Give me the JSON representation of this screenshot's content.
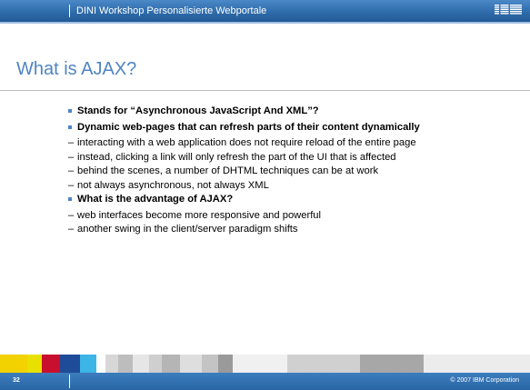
{
  "header": {
    "text": "DINI Workshop Personalisierte Webportale",
    "logo": "IBM"
  },
  "slide": {
    "title": "What is AJAX?",
    "items": [
      {
        "type": "bullet",
        "text": "Stands for “Asynchronous JavaScript And XML”?"
      },
      {
        "type": "bullet",
        "text": "Dynamic web-pages that can refresh parts of their content dynamically"
      },
      {
        "type": "dash",
        "text": "interacting with a web application does not require reload of the entire page"
      },
      {
        "type": "dash",
        "text": "instead, clicking a link will only refresh the part of the UI that is affected"
      },
      {
        "type": "dash",
        "text": "behind the scenes, a number of DHTML techniques can be at work"
      },
      {
        "type": "dash",
        "text": "not always asynchronous, not always XML"
      },
      {
        "type": "bullet",
        "text": "What is the advantage of AJAX?"
      },
      {
        "type": "dash",
        "text": "web interfaces become more responsive and powerful"
      },
      {
        "type": "dash",
        "text": "another swing in the client/server paradigm shifts"
      }
    ],
    "dash_char": "–"
  },
  "footer": {
    "page_number": "32",
    "copyright": "© 2007 IBM Corporation"
  },
  "colors": {
    "header_blue": "#2f6cab",
    "title_blue": "#4f84c4",
    "bullet_blue": "#4f84c4",
    "footer_stripe": [
      "#f2d200",
      "#e8e100",
      "#c8102e",
      "#1f4c99",
      "#3db5e6",
      "#ffffff",
      "#d7d7d7",
      "#bdbdbd",
      "#e6e6e6",
      "#cfcfcf",
      "#b5b5b5",
      "#dedede",
      "#c4c4c4",
      "#9a9a9a",
      "#f0f0f0",
      "#d0d0d0",
      "#a7a7a7",
      "#ececec"
    ]
  }
}
